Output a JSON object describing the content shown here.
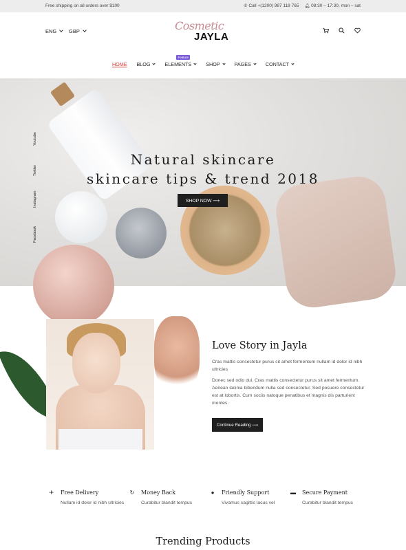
{
  "topbar": {
    "shipping": "Free shipping on all orders over $100",
    "phone": "Call +(1200) 987 118 765",
    "hours": "08:30 – 17:30, mon – sat"
  },
  "header": {
    "language": "ENG",
    "currency": "GBP",
    "logo_script": "Cosmetic",
    "logo_brand": "JAYLA",
    "icons": [
      "cart-icon",
      "search-icon",
      "heart-icon"
    ]
  },
  "nav": {
    "items": [
      {
        "label": "HOME",
        "active": true
      },
      {
        "label": "BLOG"
      },
      {
        "label": "ELEMENTS",
        "badge": "Feature"
      },
      {
        "label": "SHOP"
      },
      {
        "label": "PAGES"
      },
      {
        "label": "CONTACT"
      }
    ]
  },
  "hero": {
    "title_line1": "Natural skincare",
    "title_line2": "skincare tips & trend 2018",
    "button": "SHOP NOW ⟶",
    "social": [
      "Youtube",
      "Twitter",
      "Instagram",
      "Facebook"
    ]
  },
  "story": {
    "title": "Love Story in Jayla",
    "p1": "Cras mattis consectetur purus sit amet fermentum nullam id dolor id nibh ultricies",
    "p2": "Donec sed odio dui. Cras mattis consectetur purus sit amet fermentum. Aenean lacinia bibendum nulla sed consectetur. Sed posuere consectetur est at lobortis. Cum sociis natoque penatibus et magnis dis parturient montes.",
    "button": "Continue Reading ⟶"
  },
  "features": [
    {
      "icon": "airplane-icon",
      "title": "Free Delivery",
      "desc": "Nullam id dolor id nibh ultricies"
    },
    {
      "icon": "refresh-icon",
      "title": "Money Back",
      "desc": "Curabitur blandit tempus"
    },
    {
      "icon": "support-icon",
      "title": "Friendly Support",
      "desc": "Vivamus sagittis lacus vel"
    },
    {
      "icon": "card-icon",
      "title": "Secure Payment",
      "desc": "Curabitur blandit tempus"
    }
  ],
  "trending_title": "Trending Products",
  "colors": {
    "accent": "#d23a3a",
    "badge": "#7b5cd6",
    "button": "#1f1f1f"
  }
}
